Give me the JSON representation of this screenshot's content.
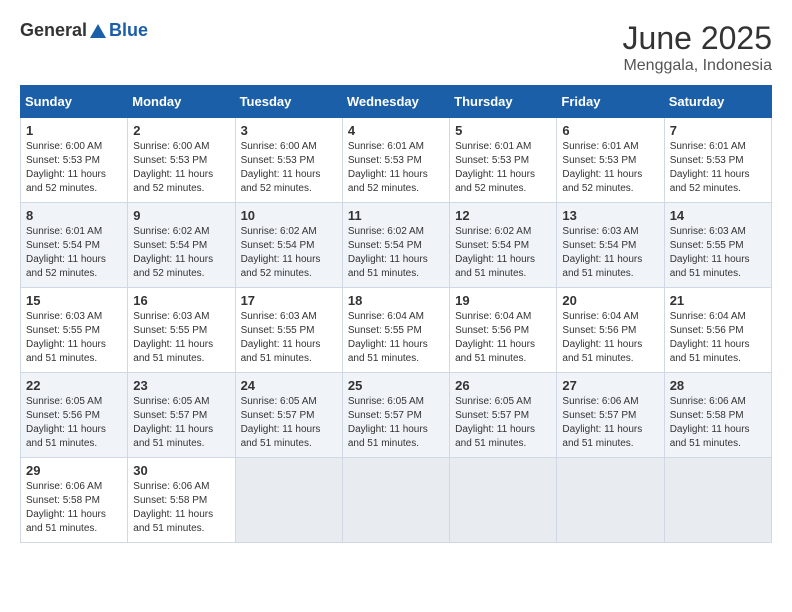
{
  "logo": {
    "general": "General",
    "blue": "Blue"
  },
  "title": "June 2025",
  "location": "Menggala, Indonesia",
  "days": [
    "Sunday",
    "Monday",
    "Tuesday",
    "Wednesday",
    "Thursday",
    "Friday",
    "Saturday"
  ],
  "weeks": [
    [
      {
        "day": "1",
        "sunrise": "6:00 AM",
        "sunset": "5:53 PM",
        "daylight": "11 hours and 52 minutes."
      },
      {
        "day": "2",
        "sunrise": "6:00 AM",
        "sunset": "5:53 PM",
        "daylight": "11 hours and 52 minutes."
      },
      {
        "day": "3",
        "sunrise": "6:00 AM",
        "sunset": "5:53 PM",
        "daylight": "11 hours and 52 minutes."
      },
      {
        "day": "4",
        "sunrise": "6:01 AM",
        "sunset": "5:53 PM",
        "daylight": "11 hours and 52 minutes."
      },
      {
        "day": "5",
        "sunrise": "6:01 AM",
        "sunset": "5:53 PM",
        "daylight": "11 hours and 52 minutes."
      },
      {
        "day": "6",
        "sunrise": "6:01 AM",
        "sunset": "5:53 PM",
        "daylight": "11 hours and 52 minutes."
      },
      {
        "day": "7",
        "sunrise": "6:01 AM",
        "sunset": "5:53 PM",
        "daylight": "11 hours and 52 minutes."
      }
    ],
    [
      {
        "day": "8",
        "sunrise": "6:01 AM",
        "sunset": "5:54 PM",
        "daylight": "11 hours and 52 minutes."
      },
      {
        "day": "9",
        "sunrise": "6:02 AM",
        "sunset": "5:54 PM",
        "daylight": "11 hours and 52 minutes."
      },
      {
        "day": "10",
        "sunrise": "6:02 AM",
        "sunset": "5:54 PM",
        "daylight": "11 hours and 52 minutes."
      },
      {
        "day": "11",
        "sunrise": "6:02 AM",
        "sunset": "5:54 PM",
        "daylight": "11 hours and 51 minutes."
      },
      {
        "day": "12",
        "sunrise": "6:02 AM",
        "sunset": "5:54 PM",
        "daylight": "11 hours and 51 minutes."
      },
      {
        "day": "13",
        "sunrise": "6:03 AM",
        "sunset": "5:54 PM",
        "daylight": "11 hours and 51 minutes."
      },
      {
        "day": "14",
        "sunrise": "6:03 AM",
        "sunset": "5:55 PM",
        "daylight": "11 hours and 51 minutes."
      }
    ],
    [
      {
        "day": "15",
        "sunrise": "6:03 AM",
        "sunset": "5:55 PM",
        "daylight": "11 hours and 51 minutes."
      },
      {
        "day": "16",
        "sunrise": "6:03 AM",
        "sunset": "5:55 PM",
        "daylight": "11 hours and 51 minutes."
      },
      {
        "day": "17",
        "sunrise": "6:03 AM",
        "sunset": "5:55 PM",
        "daylight": "11 hours and 51 minutes."
      },
      {
        "day": "18",
        "sunrise": "6:04 AM",
        "sunset": "5:55 PM",
        "daylight": "11 hours and 51 minutes."
      },
      {
        "day": "19",
        "sunrise": "6:04 AM",
        "sunset": "5:56 PM",
        "daylight": "11 hours and 51 minutes."
      },
      {
        "day": "20",
        "sunrise": "6:04 AM",
        "sunset": "5:56 PM",
        "daylight": "11 hours and 51 minutes."
      },
      {
        "day": "21",
        "sunrise": "6:04 AM",
        "sunset": "5:56 PM",
        "daylight": "11 hours and 51 minutes."
      }
    ],
    [
      {
        "day": "22",
        "sunrise": "6:05 AM",
        "sunset": "5:56 PM",
        "daylight": "11 hours and 51 minutes."
      },
      {
        "day": "23",
        "sunrise": "6:05 AM",
        "sunset": "5:57 PM",
        "daylight": "11 hours and 51 minutes."
      },
      {
        "day": "24",
        "sunrise": "6:05 AM",
        "sunset": "5:57 PM",
        "daylight": "11 hours and 51 minutes."
      },
      {
        "day": "25",
        "sunrise": "6:05 AM",
        "sunset": "5:57 PM",
        "daylight": "11 hours and 51 minutes."
      },
      {
        "day": "26",
        "sunrise": "6:05 AM",
        "sunset": "5:57 PM",
        "daylight": "11 hours and 51 minutes."
      },
      {
        "day": "27",
        "sunrise": "6:06 AM",
        "sunset": "5:57 PM",
        "daylight": "11 hours and 51 minutes."
      },
      {
        "day": "28",
        "sunrise": "6:06 AM",
        "sunset": "5:58 PM",
        "daylight": "11 hours and 51 minutes."
      }
    ],
    [
      {
        "day": "29",
        "sunrise": "6:06 AM",
        "sunset": "5:58 PM",
        "daylight": "11 hours and 51 minutes."
      },
      {
        "day": "30",
        "sunrise": "6:06 AM",
        "sunset": "5:58 PM",
        "daylight": "11 hours and 51 minutes."
      },
      null,
      null,
      null,
      null,
      null
    ]
  ]
}
